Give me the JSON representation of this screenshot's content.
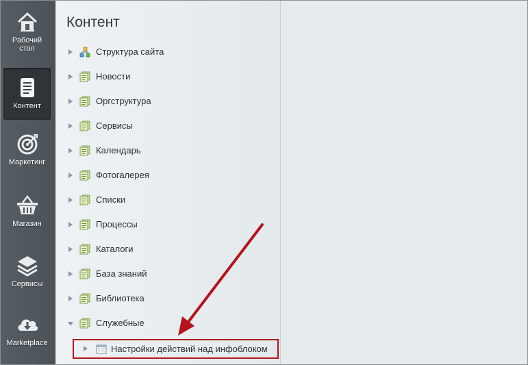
{
  "nav": {
    "items": [
      {
        "label": "Рабочий стол",
        "icon": "home-icon"
      },
      {
        "label": "Контент",
        "icon": "document-icon",
        "active": true
      },
      {
        "label": "Маркетинг",
        "icon": "target-icon"
      },
      {
        "label": "Магазин",
        "icon": "basket-icon"
      },
      {
        "label": "Сервисы",
        "icon": "layers-icon"
      },
      {
        "label": "Marketplace",
        "icon": "cloud-download-icon"
      }
    ]
  },
  "panel": {
    "title": "Контент",
    "tree": [
      {
        "label": "Структура сайта",
        "icon": "site-structure-icon"
      },
      {
        "label": "Новости",
        "icon": "infoblock-icon"
      },
      {
        "label": "Оргструктура",
        "icon": "infoblock-icon"
      },
      {
        "label": "Сервисы",
        "icon": "infoblock-icon"
      },
      {
        "label": "Календарь",
        "icon": "infoblock-icon"
      },
      {
        "label": "Фотогалерея",
        "icon": "infoblock-icon"
      },
      {
        "label": "Списки",
        "icon": "infoblock-icon"
      },
      {
        "label": "Процессы",
        "icon": "infoblock-icon"
      },
      {
        "label": "Каталоги",
        "icon": "infoblock-icon"
      },
      {
        "label": "База знаний",
        "icon": "infoblock-icon"
      },
      {
        "label": "Библиотека",
        "icon": "infoblock-icon"
      },
      {
        "label": "Служебные",
        "icon": "infoblock-icon",
        "expanded": true
      }
    ],
    "subitem": {
      "label": "Настройки действий над инфоблоком",
      "icon": "settings-form-icon"
    }
  },
  "colors": {
    "highlight": "#b3141c",
    "annotation_arrow": "#b3141c"
  }
}
